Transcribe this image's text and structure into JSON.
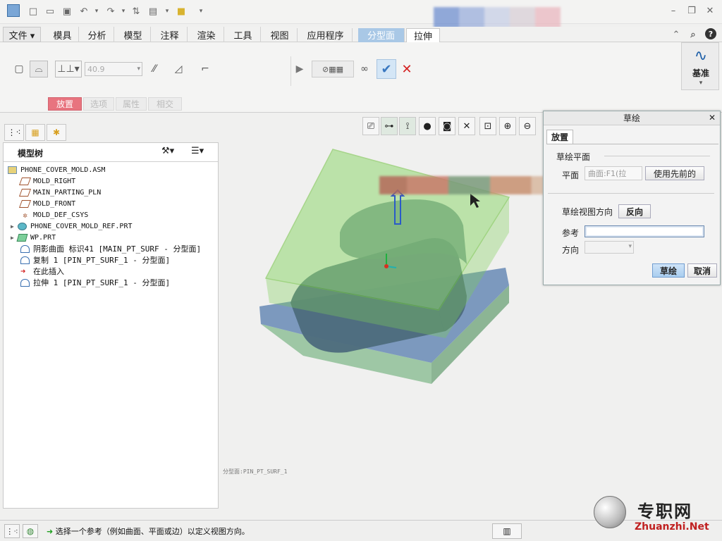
{
  "menubar": {
    "tabs": [
      {
        "label": "文件 ▾"
      },
      {
        "label": "模具"
      },
      {
        "label": "分析"
      },
      {
        "label": "模型"
      },
      {
        "label": "注释"
      },
      {
        "label": "渲染"
      },
      {
        "label": "工具"
      },
      {
        "label": "视图"
      },
      {
        "label": "应用程序"
      },
      {
        "label": "分型面"
      },
      {
        "label": "拉伸"
      }
    ]
  },
  "ribbon": {
    "depth_value": "40.9",
    "subtabs": [
      "放置",
      "选项",
      "属性",
      "相交"
    ],
    "datum_label": "基准"
  },
  "left_panel": {
    "title": "模型树",
    "tree": [
      {
        "label": "PHONE_COVER_MOLD.ASM",
        "icon": "assembly-icon"
      },
      {
        "label": "MOLD_RIGHT",
        "icon": "datum-plane-icon"
      },
      {
        "label": "MAIN_PARTING_PLN",
        "icon": "datum-plane-icon"
      },
      {
        "label": "MOLD_FRONT",
        "icon": "datum-plane-icon"
      },
      {
        "label": "MOLD_DEF_CSYS",
        "icon": "csys-icon"
      },
      {
        "label": "PHONE_COVER_MOLD_REF.PRT",
        "icon": "part-icon"
      },
      {
        "label": "WP.PRT",
        "icon": "workpiece-icon"
      },
      {
        "label": "阴影曲面 标识41 [MAIN_PT_SURF - 分型面]",
        "icon": "surface-icon"
      },
      {
        "label": "复制 1 [PIN_PT_SURF_1 - 分型面]",
        "icon": "surface-icon"
      },
      {
        "label": "在此插入",
        "icon": "insert-arrow-icon"
      },
      {
        "label": "拉伸 1 [PIN_PT_SURF_1 - 分型面]",
        "icon": "surface-icon"
      }
    ]
  },
  "viewport": {
    "feature_label": "分型面:PIN_PT_SURF_1"
  },
  "dialog": {
    "title": "草绘",
    "tab": "放置",
    "section": "草绘平面",
    "plane_label": "平面",
    "plane_value": "曲面:F1(拉",
    "use_previous": "使用先前的",
    "view_dir_label": "草绘视图方向",
    "flip": "反向",
    "reference_label": "参考",
    "orientation_label": "方向",
    "ok": "草绘",
    "cancel": "取消"
  },
  "status": {
    "message": "选择一个参考（例如曲面、平面或边）以定义视图方向。"
  },
  "watermark": {
    "cn": "专职网",
    "en": "Zhuanzhi.Net"
  },
  "colors": {
    "accent_blue": "#8eb8e0",
    "active_tab": "#e8747f",
    "mold_green": "#7fcf5a",
    "mold_blue": "#6f8fb8"
  }
}
